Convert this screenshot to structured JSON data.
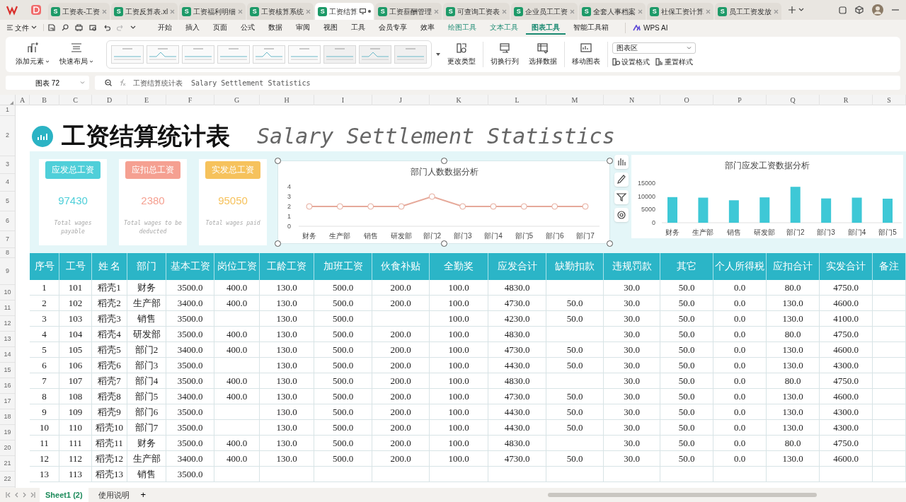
{
  "title_tabs": [
    {
      "badge": "S",
      "label": "工资表-工资",
      "selected": false
    },
    {
      "badge": "S",
      "label": "工资反算表.xl",
      "selected": false
    },
    {
      "badge": "S",
      "label": "工资福利明细",
      "selected": false
    },
    {
      "badge": "S",
      "label": "工资核算系统",
      "selected": false
    },
    {
      "badge": "S",
      "label": "工资结算",
      "selected": true
    },
    {
      "badge": "S",
      "label": "工资薪酬管理",
      "selected": false
    },
    {
      "badge": "S",
      "label": "可查询工资表",
      "selected": false
    },
    {
      "badge": "S",
      "label": "企业员工工资",
      "selected": false
    },
    {
      "badge": "S",
      "label": "全套人事档案",
      "selected": false
    },
    {
      "badge": "S",
      "label": "社保工资计算",
      "selected": false
    },
    {
      "badge": "S",
      "label": "员工工资发放",
      "selected": false
    }
  ],
  "menu": {
    "file": "文件",
    "items": [
      {
        "label": "开始",
        "kind": "main",
        "selected": false
      },
      {
        "label": "插入",
        "kind": "main",
        "selected": false
      },
      {
        "label": "页面",
        "kind": "main",
        "selected": false
      },
      {
        "label": "公式",
        "kind": "main",
        "selected": false
      },
      {
        "label": "数据",
        "kind": "main",
        "selected": false
      },
      {
        "label": "审阅",
        "kind": "main",
        "selected": false
      },
      {
        "label": "视图",
        "kind": "main",
        "selected": false
      },
      {
        "label": "工具",
        "kind": "main",
        "selected": false
      },
      {
        "label": "会员专享",
        "kind": "main",
        "selected": false
      },
      {
        "label": "效率",
        "kind": "main",
        "selected": false
      },
      {
        "label": "绘图工具",
        "kind": "contextual",
        "selected": false
      },
      {
        "label": "文本工具",
        "kind": "contextual",
        "selected": false
      },
      {
        "label": "图表工具",
        "kind": "contextual",
        "selected": true
      },
      {
        "label": "智能工具箱",
        "kind": "main",
        "selected": false
      }
    ],
    "ai": "WPS AI"
  },
  "ribbon": {
    "add_element": "添加元素",
    "quick_layout": "快速布局",
    "change_type": "更改类型",
    "switch_row_col": "切换行列",
    "select_data": "选择数据",
    "move_chart": "移动图表",
    "element_dropdown": "图表区",
    "set_format": "设置格式",
    "reset_style": "重置样式"
  },
  "formula_bar": {
    "name_box": "图表 72",
    "formula": "工资结算统计表  Salary Settlement Statistics"
  },
  "columns": [
    "A",
    "B",
    "C",
    "D",
    "E",
    "F",
    "G",
    "H",
    "I",
    "J",
    "K",
    "L",
    "M",
    "N",
    "O",
    "P",
    "Q",
    "R",
    "S"
  ],
  "row_numbers": [
    "1",
    "2",
    "3",
    "4",
    "5",
    "6",
    "7",
    "8",
    "9",
    "10",
    "11",
    "12",
    "13",
    "14",
    "15",
    "16",
    "17",
    "18",
    "19",
    "20",
    "21",
    "22"
  ],
  "sheet_title": {
    "chinese": "工资结算统计表",
    "english": "Salary Settlement Statistics"
  },
  "cards": [
    {
      "title": "应发总工资",
      "value": "97430",
      "caption": "Total wages payable",
      "color": "#4fcfd9"
    },
    {
      "title": "应扣总工资",
      "value": "2380",
      "caption": "Total wages to be deducted",
      "color": "#f5a091"
    },
    {
      "title": "实发总工资",
      "value": "95050",
      "caption": "Total wages paid",
      "color": "#f6c25c"
    }
  ],
  "charts": [
    {
      "chart_data": {
        "type": "line",
        "title": "部门人数数据分析",
        "categories": [
          "财务",
          "生产部",
          "销售",
          "研发部",
          "部门2",
          "部门3",
          "部门4",
          "部门5",
          "部门6",
          "部门7"
        ],
        "series": [
          {
            "color": "#e6a99a",
            "marker": "circle",
            "values": [
              2,
              2,
              2,
              2,
              3,
              2,
              2,
              2,
              2,
              2
            ]
          }
        ],
        "ylim": [
          0,
          4
        ],
        "yticks": [
          0,
          1,
          2,
          3,
          4
        ]
      }
    },
    {
      "chart_data": {
        "type": "bar",
        "title": "部门应发工资数据分析",
        "categories": [
          "财务",
          "生产部",
          "销售",
          "研发部",
          "部门2",
          "部门3",
          "部门4",
          "部门5"
        ],
        "series": [
          {
            "color": "#3ec8d6",
            "values": [
              9700,
              9500,
              8500,
              9600,
              13600,
              9200,
              9500,
              9100
            ]
          }
        ],
        "ylim": [
          0,
          15000
        ],
        "yticks": [
          0,
          5000,
          10000,
          15000
        ]
      }
    }
  ],
  "table": {
    "columns": [
      "序号",
      "工号",
      "姓 名",
      "部门",
      "基本工资",
      "岗位工资",
      "工龄工资",
      "加班工资",
      "伙食补贴",
      "全勤奖",
      "应发合计",
      "缺勤扣款",
      "违规罚款",
      "其它",
      "个人所得税",
      "应扣合计",
      "实发合计",
      "备注"
    ],
    "rows": [
      [
        "1",
        "101",
        "稻壳1",
        "财务",
        "3500.0",
        "400.0",
        "130.0",
        "500.0",
        "200.0",
        "100.0",
        "4830.0",
        "",
        "30.0",
        "50.0",
        "0.0",
        "80.0",
        "4750.0",
        ""
      ],
      [
        "2",
        "102",
        "稻壳2",
        "生产部",
        "3400.0",
        "400.0",
        "130.0",
        "500.0",
        "200.0",
        "100.0",
        "4730.0",
        "50.0",
        "30.0",
        "50.0",
        "0.0",
        "130.0",
        "4600.0",
        ""
      ],
      [
        "3",
        "103",
        "稻壳3",
        "销售",
        "3500.0",
        "",
        "130.0",
        "500.0",
        "",
        "100.0",
        "4230.0",
        "50.0",
        "30.0",
        "50.0",
        "0.0",
        "130.0",
        "4100.0",
        ""
      ],
      [
        "4",
        "104",
        "稻壳4",
        "研发部",
        "3500.0",
        "400.0",
        "130.0",
        "500.0",
        "200.0",
        "100.0",
        "4830.0",
        "",
        "30.0",
        "50.0",
        "0.0",
        "80.0",
        "4750.0",
        ""
      ],
      [
        "5",
        "105",
        "稻壳5",
        "部门2",
        "3400.0",
        "400.0",
        "130.0",
        "500.0",
        "200.0",
        "100.0",
        "4730.0",
        "50.0",
        "30.0",
        "50.0",
        "0.0",
        "130.0",
        "4600.0",
        ""
      ],
      [
        "6",
        "106",
        "稻壳6",
        "部门3",
        "3500.0",
        "",
        "130.0",
        "500.0",
        "200.0",
        "100.0",
        "4430.0",
        "50.0",
        "30.0",
        "50.0",
        "0.0",
        "130.0",
        "4300.0",
        ""
      ],
      [
        "7",
        "107",
        "稻壳7",
        "部门4",
        "3500.0",
        "400.0",
        "130.0",
        "500.0",
        "200.0",
        "100.0",
        "4830.0",
        "",
        "30.0",
        "50.0",
        "0.0",
        "80.0",
        "4750.0",
        ""
      ],
      [
        "8",
        "108",
        "稻壳8",
        "部门5",
        "3400.0",
        "400.0",
        "130.0",
        "500.0",
        "200.0",
        "100.0",
        "4730.0",
        "50.0",
        "30.0",
        "50.0",
        "0.0",
        "130.0",
        "4600.0",
        ""
      ],
      [
        "9",
        "109",
        "稻壳9",
        "部门6",
        "3500.0",
        "",
        "130.0",
        "500.0",
        "200.0",
        "100.0",
        "4430.0",
        "50.0",
        "30.0",
        "50.0",
        "0.0",
        "130.0",
        "4300.0",
        ""
      ],
      [
        "10",
        "110",
        "稻壳10",
        "部门7",
        "3500.0",
        "",
        "130.0",
        "500.0",
        "200.0",
        "100.0",
        "4430.0",
        "50.0",
        "30.0",
        "50.0",
        "0.0",
        "130.0",
        "4300.0",
        ""
      ],
      [
        "11",
        "111",
        "稻壳11",
        "财务",
        "3500.0",
        "400.0",
        "130.0",
        "500.0",
        "200.0",
        "100.0",
        "4830.0",
        "",
        "30.0",
        "50.0",
        "0.0",
        "80.0",
        "4750.0",
        ""
      ],
      [
        "12",
        "112",
        "稻壳12",
        "生产部",
        "3400.0",
        "400.0",
        "130.0",
        "500.0",
        "200.0",
        "100.0",
        "4730.0",
        "50.0",
        "30.0",
        "50.0",
        "0.0",
        "130.0",
        "4600.0",
        ""
      ],
      [
        "13",
        "113",
        "稻壳13",
        "销售",
        "3500.0",
        "",
        "",
        "",
        "",
        "",
        "",
        "",
        "",
        "",
        "",
        "",
        "",
        ""
      ]
    ]
  },
  "sheet_tabs": [
    {
      "label": "Sheet1 (2)",
      "selected": true
    },
    {
      "label": "使用说明",
      "selected": false
    }
  ],
  "add_sheet": "+"
}
